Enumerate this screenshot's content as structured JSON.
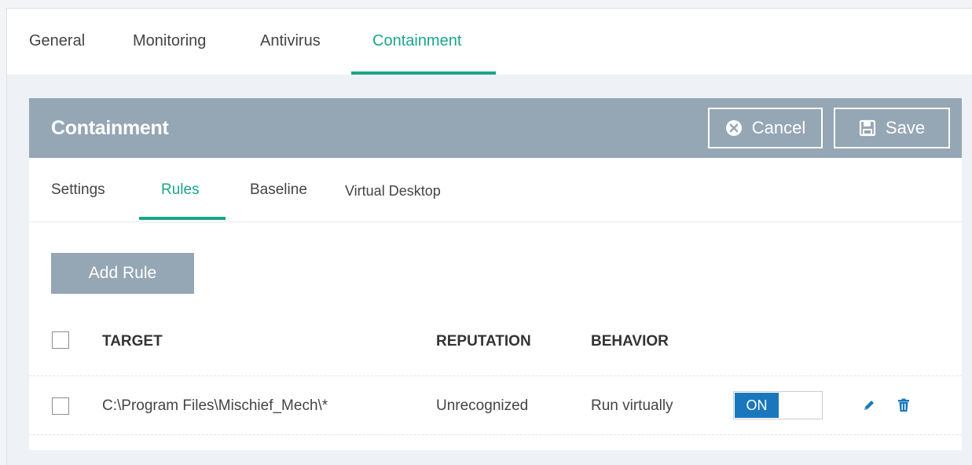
{
  "top_tabs": [
    {
      "label": "General"
    },
    {
      "label": "Monitoring"
    },
    {
      "label": "Antivirus"
    },
    {
      "label": "Containment",
      "active": true
    }
  ],
  "panel": {
    "title": "Containment",
    "cancel_label": "Cancel",
    "save_label": "Save"
  },
  "sub_tabs": [
    {
      "label": "Settings"
    },
    {
      "label": "Rules",
      "active": true
    },
    {
      "label": "Baseline"
    },
    {
      "label": "Virtual Desktop"
    }
  ],
  "add_rule_label": "Add Rule",
  "table": {
    "headers": {
      "target": "TARGET",
      "reputation": "REPUTATION",
      "behavior": "BEHAVIOR"
    },
    "rows": [
      {
        "target": "C:\\Program Files\\Mischief_Mech\\*",
        "reputation": "Unrecognized",
        "behavior": "Run virtually",
        "toggle_label": "ON",
        "enabled": true
      }
    ]
  },
  "icons": {
    "cancel": "cancel-circle-icon",
    "save": "floppy-disk-icon",
    "edit": "pencil-icon",
    "delete": "trash-icon"
  },
  "colors": {
    "accent": "#1aa58a",
    "header_bg": "#95a6b5",
    "toggle_on": "#1b77bd",
    "icon_blue": "#1b77bd"
  }
}
